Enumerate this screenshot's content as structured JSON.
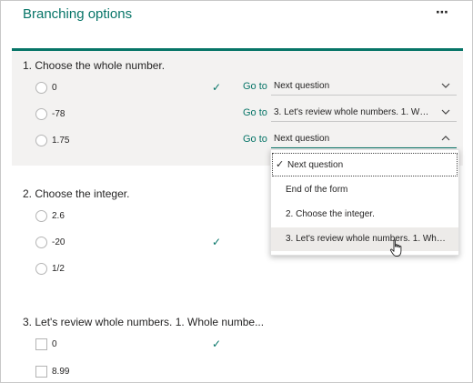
{
  "header": {
    "title": "Branching options",
    "more_label": "⋯"
  },
  "questions": [
    {
      "title": "1. Choose the whole number.",
      "options": [
        {
          "label": "0",
          "correct": true,
          "goto_label": "Go to",
          "goto_value": "Next question"
        },
        {
          "label": "-78",
          "correct": false,
          "goto_label": "Go to",
          "goto_value": "3. Let's review whole numbers. 1. Whole n..."
        },
        {
          "label": "1.75",
          "correct": false,
          "goto_label": "Go to",
          "goto_value": "Next question"
        }
      ]
    },
    {
      "title": "2. Choose the integer.",
      "options": [
        {
          "label": "2.6",
          "correct": false
        },
        {
          "label": "-20",
          "correct": true
        },
        {
          "label": "1/2",
          "correct": false
        }
      ]
    },
    {
      "title": "3. Let's review whole numbers. 1. Whole numbe...",
      "options": [
        {
          "label": "0",
          "correct": true
        },
        {
          "label": "8.99",
          "correct": false
        }
      ]
    }
  ],
  "dropdown": {
    "items": [
      {
        "label": "Next question",
        "selected": true
      },
      {
        "label": "End of the form"
      },
      {
        "label": "2. Choose the integer."
      },
      {
        "label": "3. Let's review whole numbers. 1. Whole nu...",
        "hover": true
      }
    ]
  },
  "icons": {
    "correct": "check-icon",
    "chevron_down": "chevron-down-icon",
    "chevron_up": "chevron-up-icon",
    "cursor": "hand-pointer-icon"
  },
  "colors": {
    "accent": "#077568",
    "section_bg": "#f3f2f1"
  }
}
